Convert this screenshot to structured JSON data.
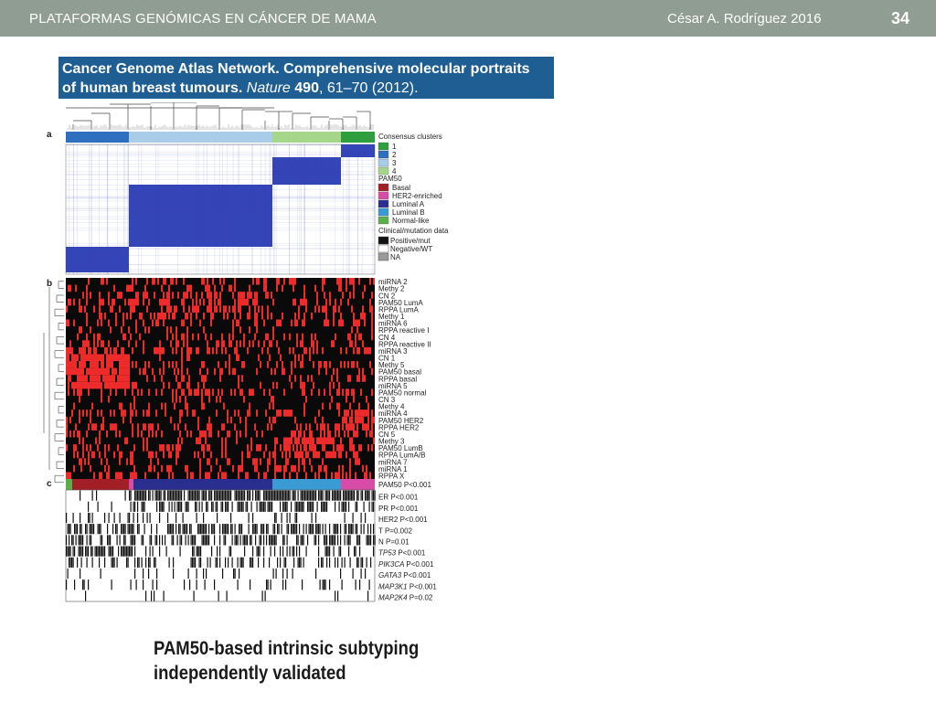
{
  "header": {
    "title": "PLATAFORMAS GENÓMICAS EN CÁNCER DE MAMA",
    "author": "César A. Rodríguez  2016",
    "page_number": "34"
  },
  "citation": {
    "line1": "Cancer Genome Atlas Network. Comprehensive molecular portraits",
    "line2_prefix": "of human breast tumours. ",
    "journal": "Nature",
    "volume": "490",
    "pages_year": ", 61–70 (2012)."
  },
  "figure": {
    "panel_labels": [
      "a",
      "b",
      "c"
    ],
    "legend": {
      "consensus_title": "Consensus clusters",
      "consensus_items": [
        {
          "label": "1",
          "color": "#2e9e3f"
        },
        {
          "label": "2",
          "color": "#2f6fbf"
        },
        {
          "label": "3",
          "color": "#a9cde8"
        },
        {
          "label": "4",
          "color": "#a6d68a"
        }
      ],
      "pam50_title": "PAM50",
      "pam50_items": [
        {
          "label": "Basal",
          "color": "#a31f27"
        },
        {
          "label": "HER2-enriched",
          "color": "#d84ba6"
        },
        {
          "label": "Luminal A",
          "color": "#2a2f8f"
        },
        {
          "label": "Luminal B",
          "color": "#3a9bd4"
        },
        {
          "label": "Normal-like",
          "color": "#59b04a"
        }
      ],
      "clinical_title": "Clinical/mutation data",
      "clinical_items": [
        {
          "label": "Positive/mut",
          "color": "#111111"
        },
        {
          "label": "Negative/WT",
          "color": "#ffffff"
        },
        {
          "label": "NA",
          "color": "#9a9a9a"
        }
      ]
    },
    "panel_b_labels": [
      "miRNA 2",
      "Methy 2",
      "CN 2",
      "PAM50 LumA",
      "RPPA LumA",
      "Methy 1",
      "miRNA 6",
      "RPPA reactive I",
      "CN 4",
      "RPPA reactive II",
      "miRNA 3",
      "CN 1",
      "Methy 5",
      "PAM50 basal",
      "RPPA basal",
      "miRNA 5",
      "PAM50 normal",
      "CN 3",
      "Methy 4",
      "miRNA 4",
      "PAM50 HER2",
      "RPPA HER2",
      "CN 5",
      "Methy 3",
      "PAM50 LumB",
      "RPPA LumA/B",
      "miRNA 7",
      "miRNA 1",
      "RPPA X"
    ],
    "panel_c_labels": [
      {
        "name": "PAM50",
        "italic": false,
        "pval": "P<0.001"
      },
      {
        "name": "ER",
        "italic": false,
        "pval": "P<0.001"
      },
      {
        "name": "PR",
        "italic": false,
        "pval": "P<0.001"
      },
      {
        "name": "HER2",
        "italic": false,
        "pval": "P<0.001"
      },
      {
        "name": "T",
        "italic": false,
        "pval": "P=0.002"
      },
      {
        "name": "N",
        "italic": false,
        "pval": "P=0.01"
      },
      {
        "name": "TP53",
        "italic": true,
        "pval": "P<0.001"
      },
      {
        "name": "PIK3CA",
        "italic": true,
        "pval": "P<0.001"
      },
      {
        "name": "GATA3",
        "italic": true,
        "pval": "P<0.001"
      },
      {
        "name": "MAP3K1",
        "italic": true,
        "pval": "P<0.001"
      },
      {
        "name": "MAP2K4",
        "italic": true,
        "pval": "P=0.02"
      }
    ],
    "colors": {
      "heatmap_blue": "#3445b8",
      "heatmap_red": "#ee2b2b",
      "heatmap_black": "#0a0a0a"
    }
  },
  "caption": {
    "line1": "PAM50-based intrinsic subtyping",
    "line2": "independently validated"
  }
}
